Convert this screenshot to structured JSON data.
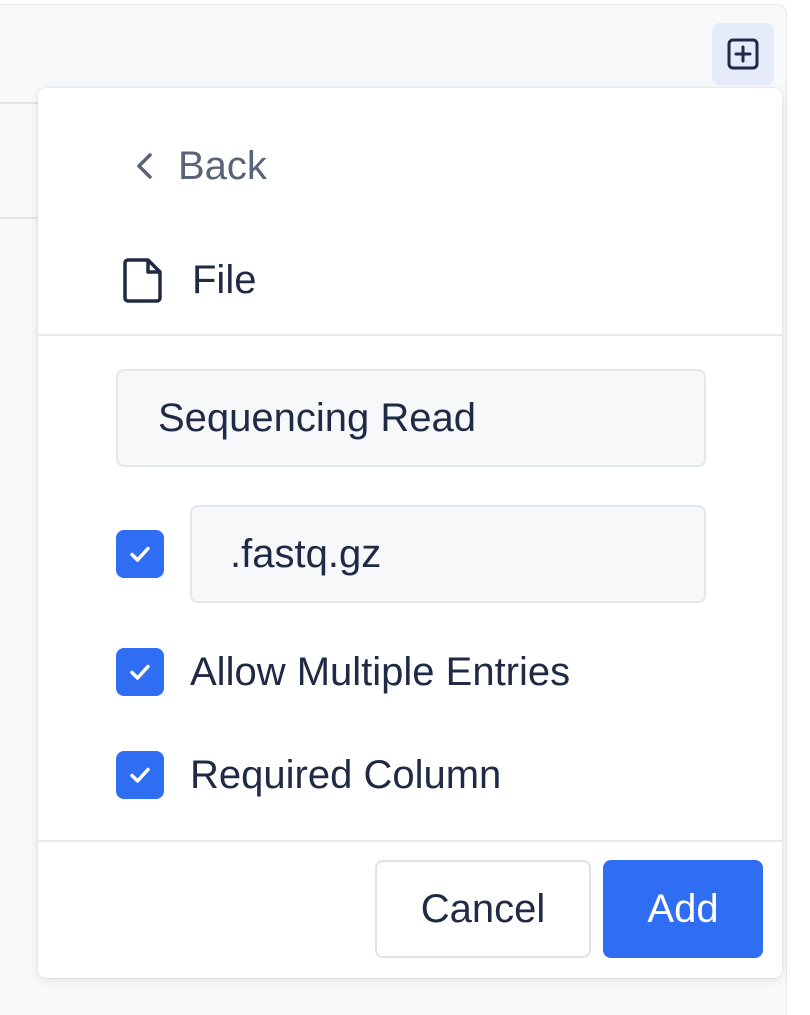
{
  "toolbar": {
    "add_column_icon": "plus-square-icon"
  },
  "popover": {
    "back_label": "Back",
    "back_icon": "chevron-left-icon",
    "column_type": {
      "icon": "file-icon",
      "label": "File"
    },
    "name_field": {
      "value": "Sequencing Read"
    },
    "extension": {
      "enabled": true,
      "value": ".fastq.gz"
    },
    "options": [
      {
        "label": "Allow Multiple Entries",
        "checked": true
      },
      {
        "label": "Required Column",
        "checked": true
      }
    ],
    "actions": {
      "cancel_label": "Cancel",
      "add_label": "Add"
    }
  },
  "colors": {
    "accent": "#2f6ef2",
    "text": "#1f2a44",
    "muted_text": "#5a6478"
  }
}
